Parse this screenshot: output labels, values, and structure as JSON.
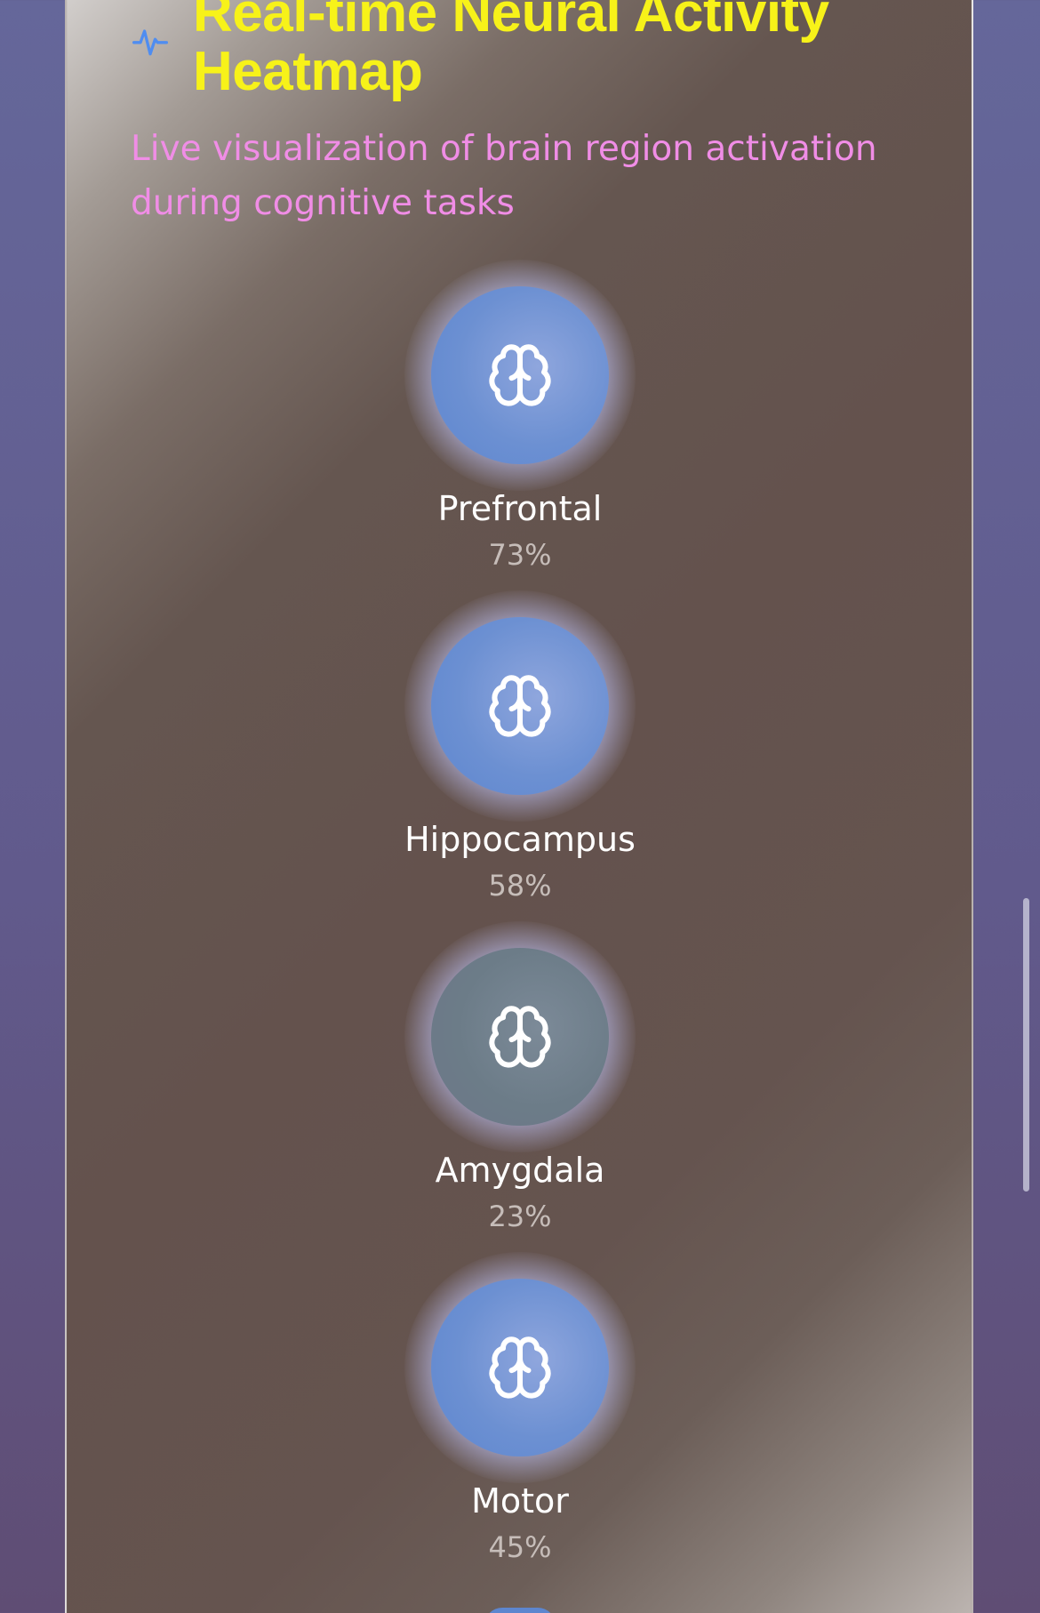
{
  "header": {
    "title": "Real-time Neural Activity Heatmap",
    "subtitle": "Live visualization of brain region activation during cognitive tasks",
    "icon": "activity-pulse-icon"
  },
  "regions": [
    {
      "name": "Prefrontal",
      "value": "73%",
      "activation": 0.73,
      "icon": "brain-icon"
    },
    {
      "name": "Hippocampus",
      "value": "58%",
      "activation": 0.58,
      "icon": "brain-icon"
    },
    {
      "name": "Amygdala",
      "value": "23%",
      "activation": 0.23,
      "icon": "brain-icon"
    },
    {
      "name": "Motor",
      "value": "45%",
      "activation": 0.45,
      "icon": "brain-icon"
    }
  ],
  "colors": {
    "title": "#f7f219",
    "subtitle": "#f08de6",
    "accent_icon": "#4f8df0",
    "orb_high": "#6c90d2",
    "orb_low": "#6c7c88"
  }
}
